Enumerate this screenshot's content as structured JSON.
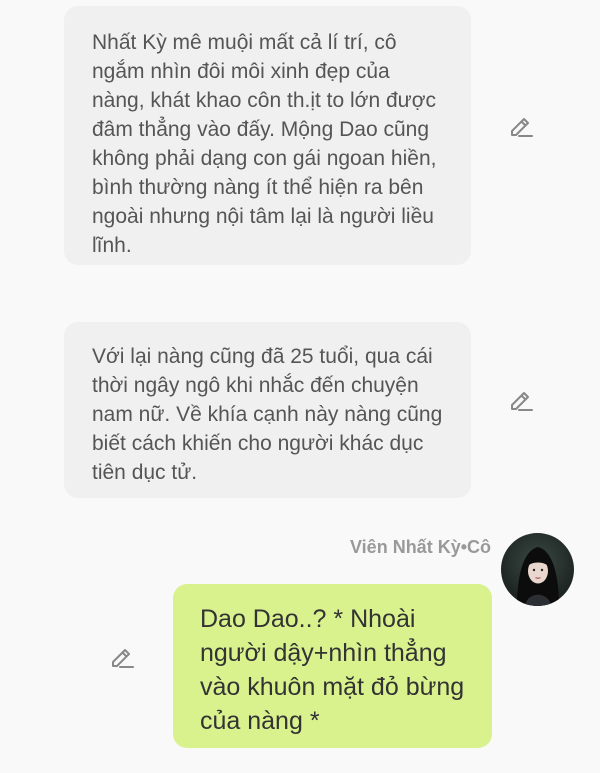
{
  "messages": [
    {
      "side": "left",
      "text": "Nhất Kỳ mê muội mất cả lí trí, cô ngắm nhìn đôi môi xinh đẹp của nàng, khát khao côn th.ịt to lớn được đâm thẳng vào đấy. Mộng Dao cũng không phải dạng con gái ngoan hiền, bình thường nàng ít thể hiện ra bên ngoài nhưng nội tâm lại là người liều lĩnh.",
      "edit_icon": "pencil-icon"
    },
    {
      "side": "left",
      "text": "Với lại nàng cũng đã 25 tuổi, qua cái thời ngây ngô khi nhắc đến chuyện nam nữ. Về khía cạnh này nàng cũng biết cách khiến cho người khác dục tiên dục tử.",
      "edit_icon": "pencil-icon"
    },
    {
      "side": "right",
      "sender": "Viên Nhất Kỳ•Cô",
      "text": "Dao Dao..? * Nhoài người dậy+nhìn thẳng vào khuôn mặt đỏ bừng của nàng *",
      "edit_icon": "pencil-icon"
    }
  ],
  "colors": {
    "background": "#f9f9f9",
    "incoming_bubble": "#f0f0f0",
    "outgoing_bubble": "#d9f28e",
    "icon": "#888888",
    "sender_name": "#999999"
  }
}
